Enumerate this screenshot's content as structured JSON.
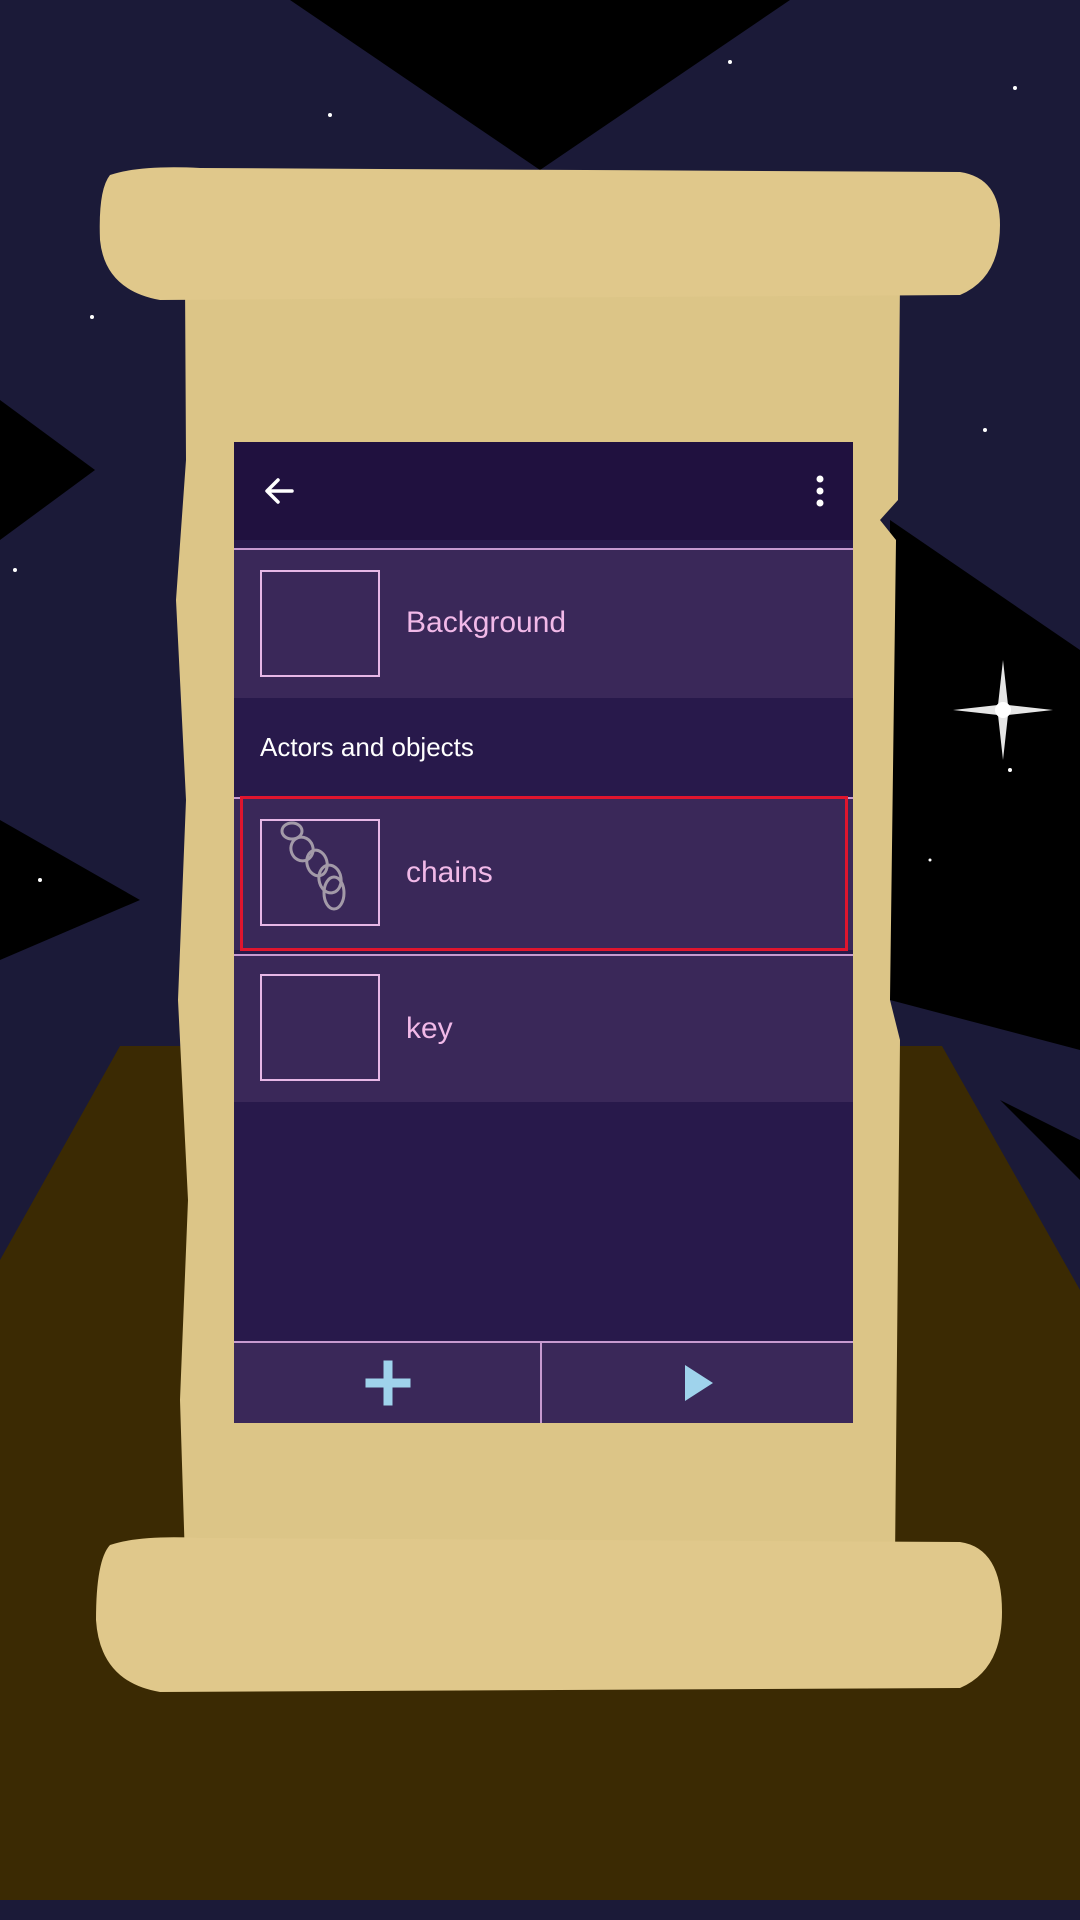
{
  "list": {
    "background_label": "Background",
    "section_header": "Actors and objects",
    "items": [
      {
        "label": "chains",
        "icon": "chains-sketch-icon",
        "selected": true
      },
      {
        "label": "key",
        "icon": "empty-thumbnail",
        "selected": false
      }
    ]
  },
  "toolbar": {
    "back_icon": "arrow-back-icon",
    "overflow_icon": "more-vert-icon"
  },
  "bottom_bar": {
    "add_icon": "plus-icon",
    "play_icon": "play-icon"
  },
  "colors": {
    "window_bg": "#28194b",
    "topbar_bg": "#20113f",
    "row_bg": "#3a2859",
    "accent_text": "#f1b9e8",
    "button_icon": "#9fd3ec",
    "selection": "#e0152e",
    "parchment": "#dcc587",
    "floor": "#3b2a03"
  }
}
